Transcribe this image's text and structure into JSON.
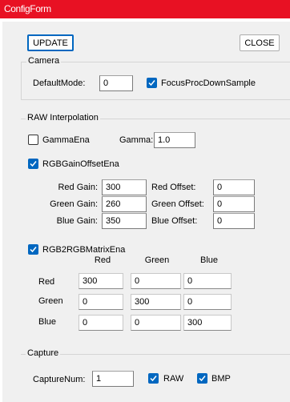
{
  "window": {
    "title": "ConfigForm"
  },
  "buttons": {
    "update": "UPDATE",
    "close": "CLOSE"
  },
  "camera": {
    "legend": "Camera",
    "default_mode_label": "DefaultMode:",
    "default_mode_value": "0",
    "focus_label": "FocusProcDownSample",
    "focus_checked": true
  },
  "raw": {
    "legend": "RAW Interpolation",
    "gamma_ena_label": "GammaEna",
    "gamma_ena_checked": false,
    "gamma_label": "Gamma:",
    "gamma_value": "1.0",
    "rgb_gain_offset_label": "RGBGainOffsetEna",
    "rgb_gain_offset_checked": true,
    "red_gain_label": "Red Gain:",
    "red_gain_value": "300",
    "green_gain_label": "Green Gain:",
    "green_gain_value": "260",
    "blue_gain_label": "Blue Gain:",
    "blue_gain_value": "350",
    "red_offset_label": "Red Offset:",
    "red_offset_value": "0",
    "green_offset_label": "Green Offset:",
    "green_offset_value": "0",
    "blue_offset_label": "Blue Offset:",
    "blue_offset_value": "0",
    "matrix_label": "RGB2RGBMatrixEna",
    "matrix_checked": true,
    "matrix_cols": [
      "Red",
      "Green",
      "Blue"
    ],
    "matrix_rows": [
      "Red",
      "Green",
      "Blue"
    ],
    "matrix_values": [
      [
        "300",
        "0",
        "0"
      ],
      [
        "0",
        "300",
        "0"
      ],
      [
        "0",
        "0",
        "300"
      ]
    ]
  },
  "capture": {
    "legend": "Capture",
    "capture_num_label": "CaptureNum:",
    "capture_num_value": "1",
    "raw_label": "RAW",
    "raw_checked": true,
    "bmp_label": "BMP",
    "bmp_checked": true
  },
  "colors": {
    "titlebar": "#e81123",
    "accent": "#0067c0",
    "background": "#f0f0f0"
  }
}
